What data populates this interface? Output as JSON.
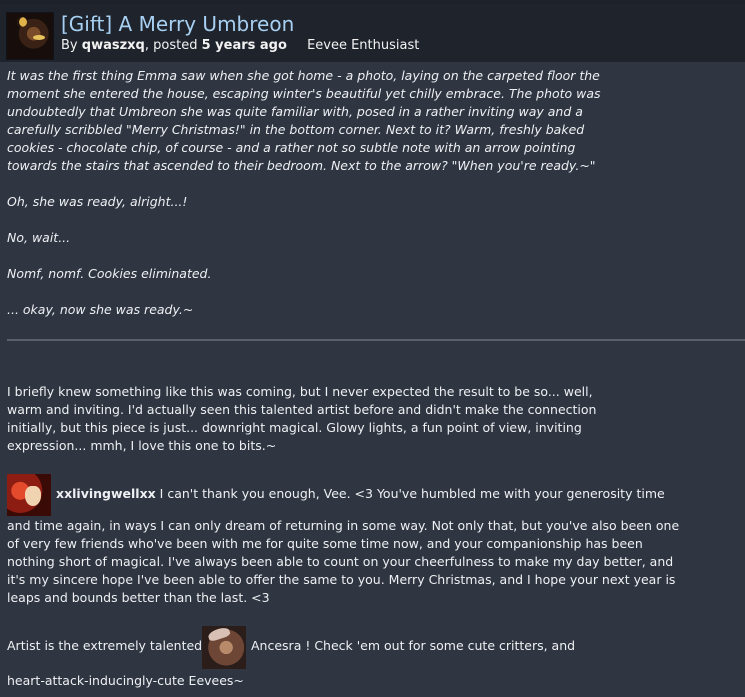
{
  "header": {
    "title": "[Gift] A Merry Umbreon",
    "by_prefix": "By",
    "author": "qwaszxq",
    "posted_prefix": ", posted",
    "posted_time": "5 years ago",
    "rank": "Eevee Enthusiast"
  },
  "story": {
    "paragraphs": [
      "It was the first thing Emma saw when she got home - a photo, laying on the carpeted floor the moment she entered the house, escaping winter's beautiful yet chilly embrace. The photo was undoubtedly that Umbreon she was quite familiar with, posed in a rather inviting way and a carefully scribbled \"Merry Christmas!\" in the bottom corner. Next to it? Warm, freshly baked cookies - chocolate chip, of course - and a rather not so subtle note with an arrow pointing towards the stairs that ascended to their bedroom. Next to the arrow? \"When you're ready.~\"",
      "Oh, she was ready, alright...!",
      "No, wait...",
      "Nomf, nomf. Cookies eliminated.",
      "... okay, now she was ready.~"
    ]
  },
  "note": "I briefly knew something like this was coming, but I never expected the result to be so... well, warm and inviting. I'd actually seen this talented artist before and didn't make the connection initially, but this piece is just... downright magical. Glowy lights, a fun point of view, inviting expression... mmh, I love this one to bits.~",
  "reply": {
    "user": "xxlivingwellxx",
    "first_line": " I can't thank you enough, Vee. <3 You've humbled me with your generosity time",
    "rest": "and time again, in ways I can only dream of returning in some way. Not only that, but you've also been one of very few friends who've been with me for quite some time now, and your companionship has been nothing short of magical. I've always been able to count on your cheerfulness to make my day better, and it's my sincere hope I've been able to offer the same to you. Merry Christmas, and I hope your next year is leaps and bounds better than the last. <3"
  },
  "artist": {
    "prefix": "Artist is the extremely talented",
    "name": "Ancesra",
    "suffix": " ! Check 'em out for some cute critters, and",
    "last_line": "heart-attack-inducingly-cute Eevees~"
  }
}
